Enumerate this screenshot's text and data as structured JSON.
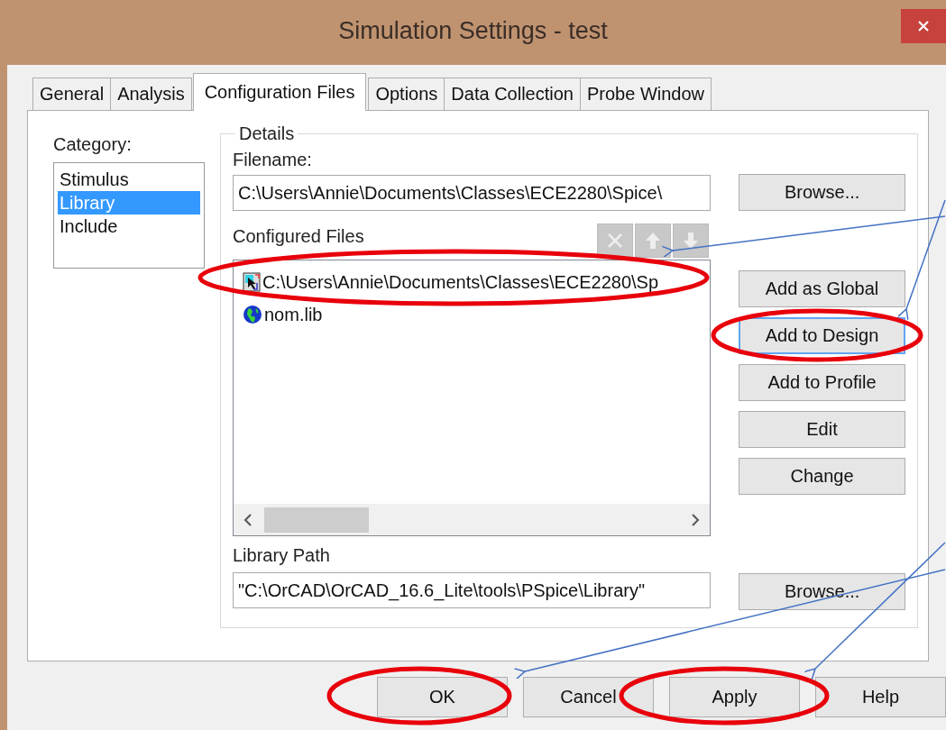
{
  "window": {
    "title": "Simulation Settings - test"
  },
  "tabs": [
    {
      "label": "General",
      "selected": false
    },
    {
      "label": "Analysis",
      "selected": false
    },
    {
      "label": "Configuration Files",
      "selected": true
    },
    {
      "label": "Options",
      "selected": false
    },
    {
      "label": "Data Collection",
      "selected": false
    },
    {
      "label": "Probe Window",
      "selected": false
    }
  ],
  "category": {
    "label": "Category:",
    "items": [
      {
        "label": "Stimulus",
        "selected": false
      },
      {
        "label": "Library",
        "selected": true
      },
      {
        "label": "Include",
        "selected": false
      }
    ]
  },
  "details": {
    "title": "Details",
    "filename_label": "Filename:",
    "filename_value": "C:\\Users\\Annie\\Documents\\Classes\\ECE2280\\Spice\\",
    "browse": "Browse...",
    "configured_label": "Configured Files",
    "toolbar": [
      {
        "kind": "delete",
        "disabled": true
      },
      {
        "kind": "up",
        "disabled": true
      },
      {
        "kind": "down",
        "disabled": true
      }
    ],
    "configured_files": [
      {
        "name": "C:\\Users\\Annie\\Documents\\Classes\\ECE2280\\Sp",
        "kind": "file"
      },
      {
        "name": "nom.lib",
        "kind": "global"
      }
    ],
    "actions": [
      {
        "label": "Add as Global",
        "focused": false
      },
      {
        "label": "Add to Design",
        "focused": true
      },
      {
        "label": "Add to Profile",
        "focused": false
      },
      {
        "label": "Edit",
        "focused": false
      },
      {
        "label": "Change",
        "focused": false
      }
    ],
    "library_path_label": "Library Path",
    "library_path_value": "\"C:\\OrCAD\\OrCAD_16.6_Lite\\tools\\PSpice\\Library\"",
    "library_browse": "Browse..."
  },
  "buttons": [
    {
      "label": "OK"
    },
    {
      "label": "Cancel"
    },
    {
      "label": "Apply"
    },
    {
      "label": "Help"
    }
  ]
}
